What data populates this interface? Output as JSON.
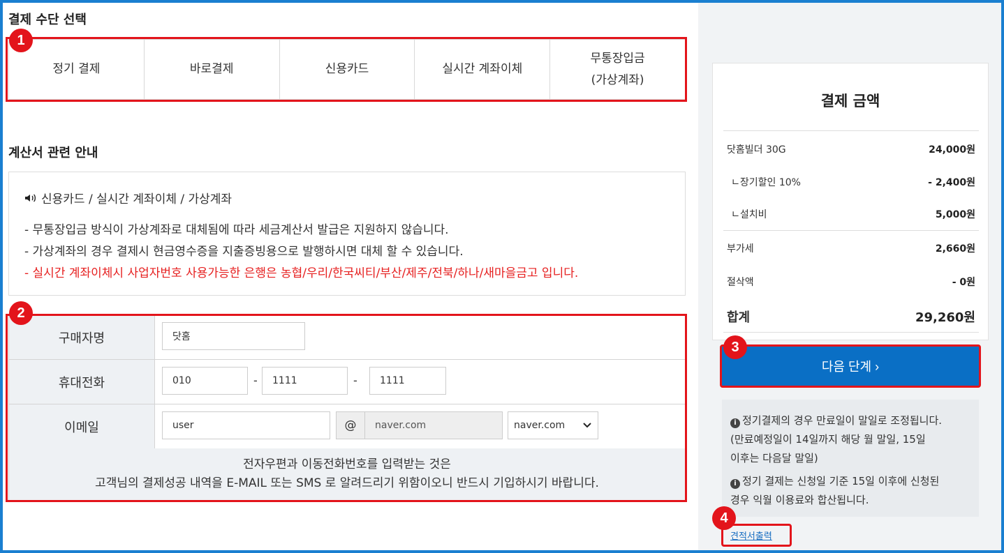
{
  "sections": {
    "payment_method_title": "결제 수단 선택",
    "invoice_title": "계산서 관련 안내"
  },
  "payment_methods": [
    {
      "label": "정기 결제"
    },
    {
      "label": "바로결제"
    },
    {
      "label": "신용카드"
    },
    {
      "label": "실시간 계좌이체"
    },
    {
      "label": "무통장입금\n(가상계좌)"
    }
  ],
  "notice": {
    "heading": "신용카드 / 실시간 계좌이체 / 가상계좌",
    "lines": [
      "- 무통장입금 방식이 가상계좌로 대체됨에 따라 세금계산서 발급은 지원하지 않습니다.",
      "- 가상계좌의 경우 결제시 현금영수증을 지출증빙용으로 발행하시면 대체 할 수 있습니다.",
      "- 실시간 계좌이체시 사업자번호 사용가능한 은행은 농협/우리/한국씨티/부산/제주/전북/하나/새마을금고 입니다."
    ]
  },
  "form": {
    "buyer_label": "구매자명",
    "buyer_value": "닷홈",
    "phone_label": "휴대전화",
    "phone": [
      "010",
      "1111",
      "1111"
    ],
    "dash": "-",
    "email_label": "이메일",
    "email_user": "user",
    "at": "@",
    "email_domain": "naver.com",
    "email_select": "naver.com",
    "note_line1": "전자우편과 이동전화번호를 입력받는 것은",
    "note_line2": "고객님의 결제성공 내역을 E-MAIL 또는 SMS 로 알려드리기 위함이오니 반드시 기입하시기 바랍니다."
  },
  "summary": {
    "title": "결제 금액",
    "rows": [
      {
        "label": "닷홈빌더 30G",
        "value": "24,000원"
      },
      {
        "label": "ㄴ장기할인 10%",
        "value": "- 2,400원"
      },
      {
        "label": "ㄴ설치비",
        "value": "5,000원"
      },
      {
        "label": "부가세",
        "value": "2,660원"
      },
      {
        "label": "절삭액",
        "value": "- 0원"
      }
    ],
    "total_label": "합계",
    "total_value": "29,260원"
  },
  "next_button": "다음 단계 ›",
  "info": {
    "line1": "정기결제의 경우 만료일이 말일로 조정됩니다.",
    "line2": "(만료예정일이 14일까지 해당 월 말일, 15일",
    "line3": "이후는 다음달 말일)",
    "line4": "정기 결제는 신청일 기준 15일 이후에 신청된",
    "line5": "경우 익월 이용료와 합산됩니다.",
    "icon": "i"
  },
  "quote_link": "견적서출력",
  "badges": [
    "1",
    "2",
    "3",
    "4"
  ],
  "colors": {
    "accent": "#0a6fc5",
    "highlight": "#e3141b",
    "warning_text": "#e62020",
    "frame": "#1a7fd0"
  }
}
